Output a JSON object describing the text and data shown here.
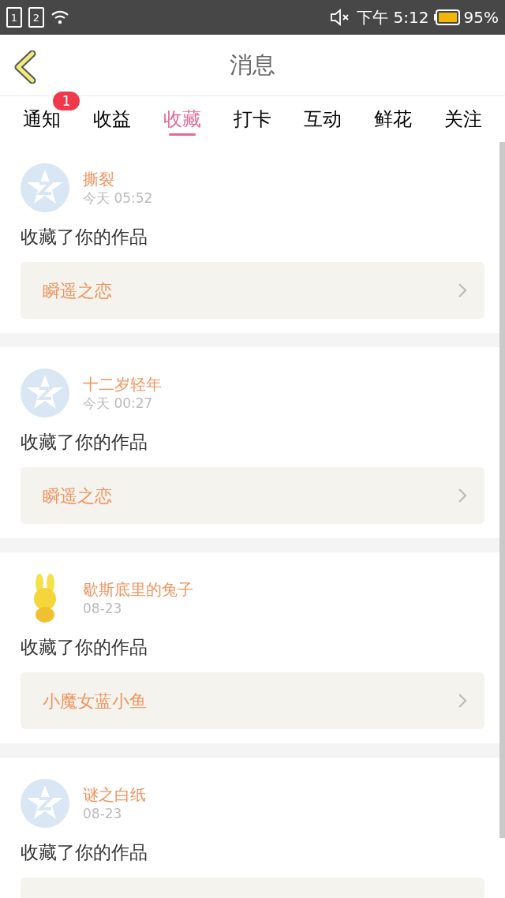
{
  "status_bar": {
    "sim_1": "1",
    "sim_2": "2",
    "time": "下午 5:12",
    "battery": "95%",
    "muted": true
  },
  "header": {
    "title": "消息"
  },
  "tabs": [
    {
      "label": "通知",
      "selected": false,
      "badge": "1"
    },
    {
      "label": "收益",
      "selected": false
    },
    {
      "label": "收藏",
      "selected": true
    },
    {
      "label": "打卡",
      "selected": false
    },
    {
      "label": "互动",
      "selected": false
    },
    {
      "label": "鲜花",
      "selected": false
    },
    {
      "label": "关注",
      "selected": false
    }
  ],
  "messages": [
    {
      "kind": "default",
      "user": "撕裂",
      "time": "今天 05:52",
      "action": "收藏了你的作品",
      "work": "瞬遥之恋"
    },
    {
      "kind": "default",
      "user": "十二岁轻年",
      "time": "今天 00:27",
      "action": "收藏了你的作品",
      "work": "瞬遥之恋"
    },
    {
      "kind": "custom",
      "user": "歇斯底里的兔子",
      "time": "08-23",
      "action": "收藏了你的作品",
      "work": "小魔女蓝小鱼"
    },
    {
      "kind": "default",
      "user": "谜之白纸",
      "time": "08-23",
      "action": "收藏了你的作品"
    }
  ]
}
